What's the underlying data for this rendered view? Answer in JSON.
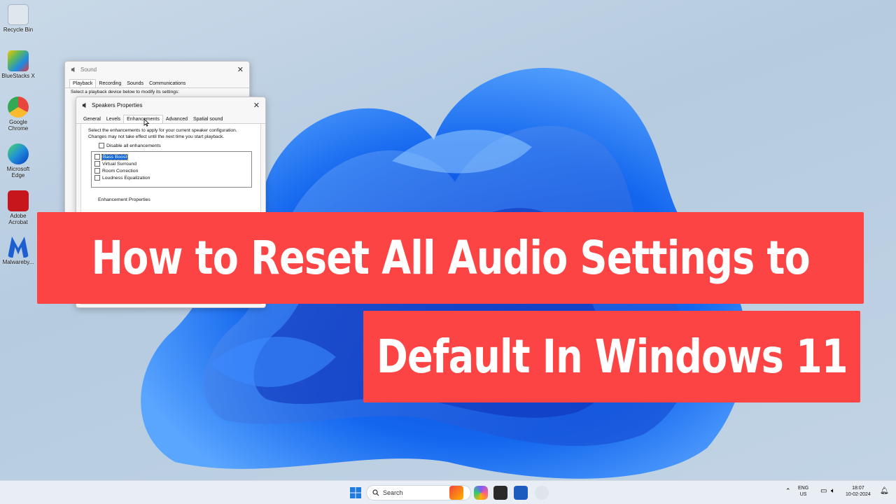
{
  "desktop": {
    "icons": [
      {
        "label": "Recycle Bin",
        "icon": "recycle-bin-icon",
        "color": "#dfe6ee"
      },
      {
        "label": "BlueStacks X",
        "icon": "bluestacks-icon",
        "color": "#5cb85c"
      },
      {
        "label": "Google Chrome",
        "icon": "chrome-icon",
        "color": "#e8453c"
      },
      {
        "label": "Microsoft Edge",
        "icon": "edge-icon",
        "color": "#1f8fd6"
      },
      {
        "label": "Adobe Acrobat",
        "icon": "acrobat-icon",
        "color": "#c8161d"
      },
      {
        "label": "Malwareby...",
        "icon": "malwarebytes-icon",
        "color": "#1d5fd0"
      }
    ]
  },
  "sound_window": {
    "title": "Sound",
    "tabs": [
      "Playback",
      "Recording",
      "Sounds",
      "Communications"
    ],
    "active_tab": "Playback",
    "hint": "Select a playback device below to modify its settings:"
  },
  "speakers_window": {
    "title": "Speakers Properties",
    "tabs": [
      "General",
      "Levels",
      "Enhancements",
      "Advanced",
      "Spatial sound"
    ],
    "active_tab": "Enhancements",
    "description": "Select the enhancements to apply for your current speaker configuration. Changes may not take effect until the next time you start playback.",
    "disable_all_label": "Disable all enhancements",
    "enhancements": [
      {
        "label": "Bass Boost",
        "selected": true
      },
      {
        "label": "Virtual Surround",
        "selected": false
      },
      {
        "label": "Room Correction",
        "selected": false
      },
      {
        "label": "Loudness Equalization",
        "selected": false
      }
    ],
    "properties_label": "Enhancement Properties"
  },
  "banners": {
    "line1": "How to Reset All Audio Settings to",
    "line2": "Default In Windows 11",
    "color": "#fd4444"
  },
  "taskbar": {
    "search_placeholder": "Search",
    "lang": "ENG",
    "region": "US",
    "time": "18:07",
    "date": "10-02-2024"
  }
}
